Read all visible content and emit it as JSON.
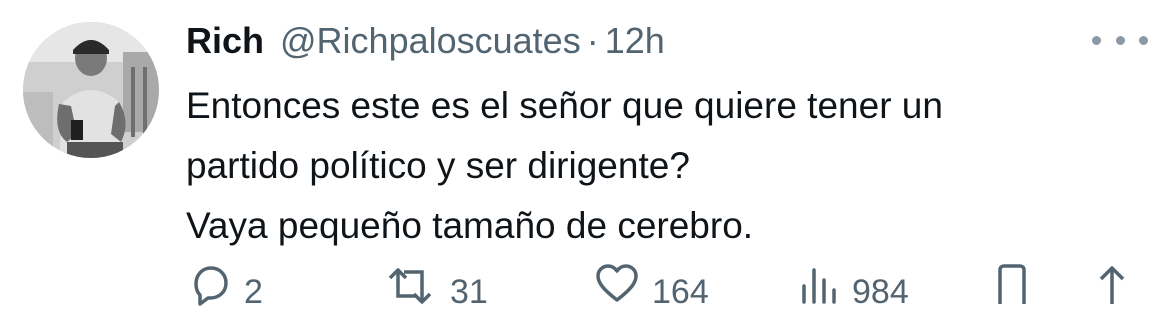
{
  "tweet": {
    "author_name": "Rich",
    "handle": "@Richpaloscuates",
    "separator": "·",
    "time": "12h",
    "text_lines": [
      "Entonces este es el señor que quiere tener un",
      "partido político y ser dirigente?",
      "Vaya pequeño tamaño de cerebro."
    ]
  },
  "actions": {
    "replies": "2",
    "retweets": "31",
    "likes": "164",
    "views": "984"
  },
  "icons": {
    "reply": "reply-icon",
    "retweet": "retweet-icon",
    "like": "heart-icon",
    "views": "views-icon",
    "bookmark": "bookmark-icon",
    "share": "share-icon",
    "more": "more-icon"
  },
  "colors": {
    "text": "#0f1419",
    "secondary": "#536471"
  }
}
